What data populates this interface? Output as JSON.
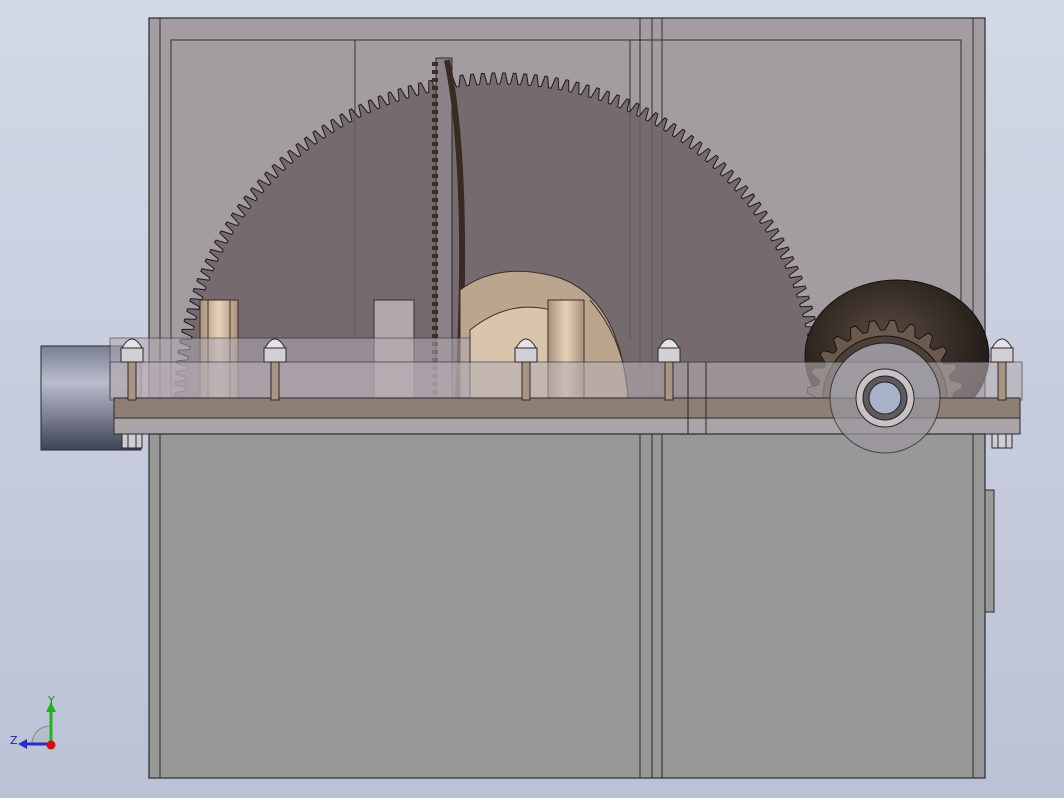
{
  "viewport": {
    "background_top": "#d3d8e6",
    "background_bottom": "#bcc2d6"
  },
  "model": {
    "lower_housing_color": "#989898",
    "upper_cover_color": "#a79fa3",
    "large_gear_color": "#6d6165",
    "pinion_color": "#2d2622",
    "flange_color": "#8d7f73",
    "bearing_color": "#c9b19a",
    "large_gear_teeth": 96,
    "pinion_teeth": 24,
    "bolt_count": 5
  },
  "triad": {
    "y_label": "Y",
    "z_label": "Z",
    "y_color": "#20b020",
    "z_color": "#2030c8",
    "x_color": "#d01010"
  }
}
